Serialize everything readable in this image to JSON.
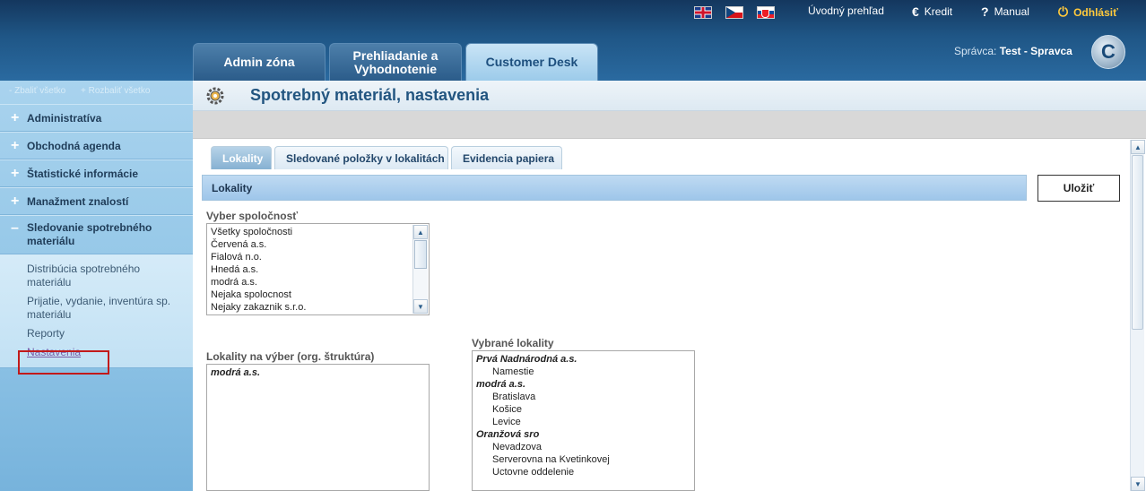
{
  "header": {
    "links": {
      "uvod": "Úvodný prehľad",
      "kredit": "Kredit",
      "manual": "Manual",
      "odhlasit": "Odhlásiť"
    },
    "tabs": [
      {
        "label_line1": "Admin zóna",
        "label_line2": ""
      },
      {
        "label_line1": "Prehliadanie a",
        "label_line2": "Vyhodnotenie"
      },
      {
        "label_line1": "Customer Desk",
        "label_line2": ""
      }
    ],
    "spravca_label": "Správca:",
    "spravca_name": "Test - Spravca",
    "logo_letter": "C"
  },
  "sidebar": {
    "collapse_all": "- Zbaliť všetko",
    "expand_all": "+ Rozbaliť všetko",
    "items": [
      {
        "sign": "+",
        "label": "Administratíva"
      },
      {
        "sign": "+",
        "label": "Obchodná agenda"
      },
      {
        "sign": "+",
        "label": "Štatistické informácie"
      },
      {
        "sign": "+",
        "label": "Manažment znalostí"
      },
      {
        "sign": "–",
        "label": "Sledovanie spotrebného materiálu"
      }
    ],
    "submenu": [
      "Distribúcia spotrebného materiálu",
      "Prijatie, vydanie, inventúra sp. materiálu",
      "Reporty",
      "Nastavenia"
    ]
  },
  "main": {
    "title": "Spotrebný materiál, nastavenia",
    "subtabs": [
      "Lokality",
      "Sledované položky v lokalitách",
      "Evidencia papiera"
    ],
    "section_title": "Lokality",
    "save_label": "Uložiť",
    "company_label": "Vyber spoločnosť",
    "companies": [
      "Všetky spoločnosti",
      "Červená a.s.",
      "Fialová n.o.",
      "Hnedá a.s.",
      "modrá a.s.",
      "Nejaka spolocnost",
      "Nejaky zakaznik s.r.o."
    ],
    "locations_label": "Lokality na výber (org. štruktúra)",
    "locations": [
      "modrá a.s."
    ],
    "selected_label": "Vybrané lokality",
    "selected": [
      {
        "group": "Prvá Nadnárodná a.s.",
        "items": [
          "Namestie"
        ]
      },
      {
        "group": "modrá a.s.",
        "items": [
          "Bratislava",
          "Košice",
          "Levice"
        ]
      },
      {
        "group": "Oranžová sro",
        "items": [
          "Nevadzova",
          "Serverovna na Kvetinkovej",
          "Uctovne oddelenie"
        ]
      }
    ]
  },
  "colors": {
    "header_dark": "#14375e",
    "accent_blue": "#225580",
    "logout_yellow": "#ffc93c",
    "highlight_red": "#c21a1a"
  },
  "icons": {
    "uvod": "none",
    "kredit": "euro-icon",
    "manual": "question-icon",
    "odhlasit": "power-icon",
    "title": "gear-icon"
  }
}
